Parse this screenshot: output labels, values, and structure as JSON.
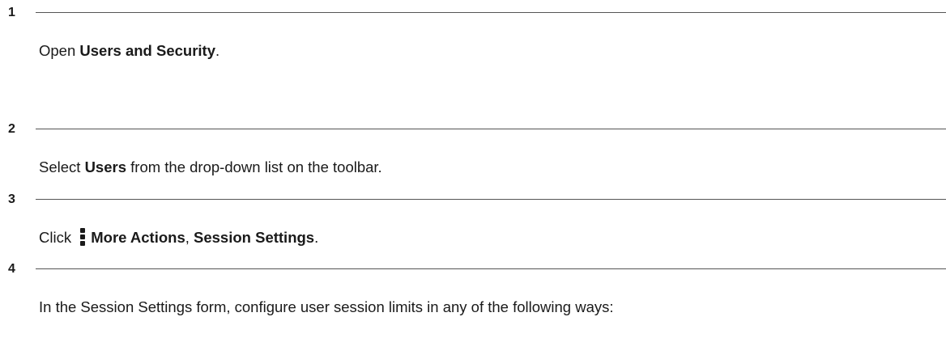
{
  "steps": [
    {
      "number": "1",
      "prefix": "Open ",
      "bold": "Users and Security",
      "suffix": "."
    },
    {
      "number": "2",
      "prefix": "Select ",
      "bold": "Users",
      "suffix": " from the drop-down list on the toolbar."
    },
    {
      "number": "3",
      "prefix": "Click ",
      "icon": "more-actions-icon",
      "bold": "More Actions",
      "separator": ", ",
      "bold2": "Session Settings",
      "suffix": "."
    },
    {
      "number": "4",
      "text": "In the Session Settings form, configure user session limits in any of the following ways:"
    }
  ]
}
